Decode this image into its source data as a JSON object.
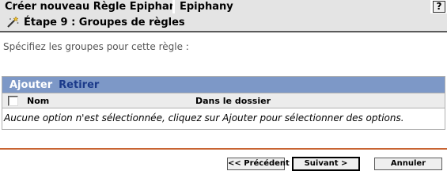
{
  "window": {
    "title": "Créer nouveau Règle Epiphany",
    "app": "Epiphany",
    "help_label": "?"
  },
  "step": {
    "icon": "wand-icon",
    "title": "Étape 9 : Groupes de règles"
  },
  "main": {
    "instruction": "Spécifiez les groupes pour cette règle :"
  },
  "panel": {
    "toolbar": {
      "add_label": "Ajouter",
      "remove_label": "Retirer"
    },
    "columns": [
      "Nom",
      "Dans le dossier"
    ],
    "empty_message": "Aucune option n'est sélectionnée, cliquez sur Ajouter pour sélectionner des options."
  },
  "footer": {
    "prev_label": "<< Précédent",
    "next_label": "Suivant >",
    "cancel_label": "Annuler"
  },
  "colors": {
    "toolbar": "#7d98c7",
    "footer_rule": "#c86432",
    "title_bg": "#e4e4e4"
  }
}
